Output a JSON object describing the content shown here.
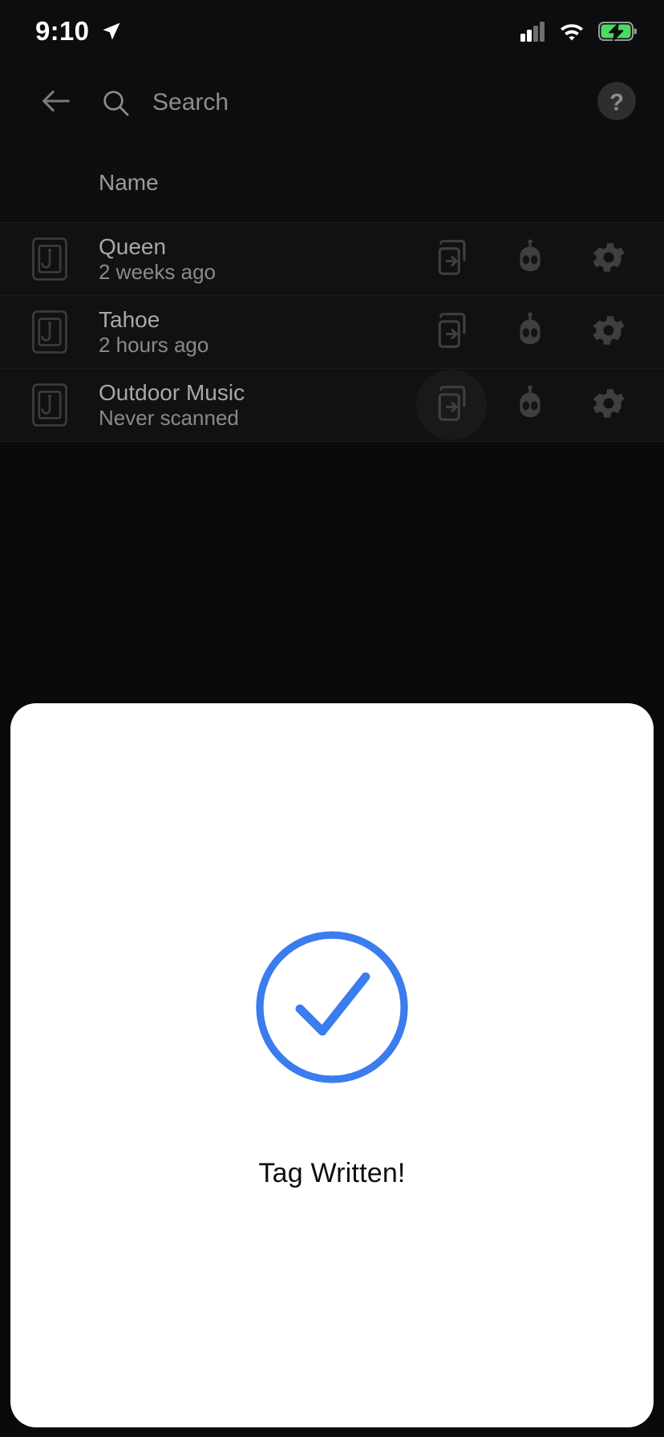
{
  "status_bar": {
    "time": "9:10",
    "icons": [
      "location-arrow-icon",
      "cellular-signal-icon",
      "wifi-icon",
      "battery-charging-icon"
    ],
    "battery_color": "#4cd964"
  },
  "app_bar": {
    "back_label": "back-arrow-icon",
    "search_placeholder": "Search",
    "search_value": "",
    "help_label": "?"
  },
  "list_header": {
    "name_column": "Name"
  },
  "tags": [
    {
      "icon": "nfc-tag-icon",
      "name": "Queen",
      "last_scanned": "2 weeks ago",
      "pressed": false
    },
    {
      "icon": "nfc-tag-icon",
      "name": "Tahoe",
      "last_scanned": "2 hours ago",
      "pressed": false
    },
    {
      "icon": "nfc-tag-icon",
      "name": "Outdoor Music",
      "last_scanned": "Never scanned",
      "pressed": true
    }
  ],
  "row_actions": {
    "write": "write-to-tag-icon",
    "automation": "robot-icon",
    "settings": "gear-icon"
  },
  "dialog": {
    "icon": "check-circle-icon",
    "message": "Tag Written!",
    "accent_color": "#3b7cee",
    "background_color": "#ffffff"
  },
  "theme": {
    "background": "#0a0a0a",
    "row_background": "#111111",
    "divider": "#1c1c1c",
    "text_primary": "#a8a8a8",
    "text_secondary": "#8a8a8a",
    "icon_color": "#3c3c3c"
  }
}
